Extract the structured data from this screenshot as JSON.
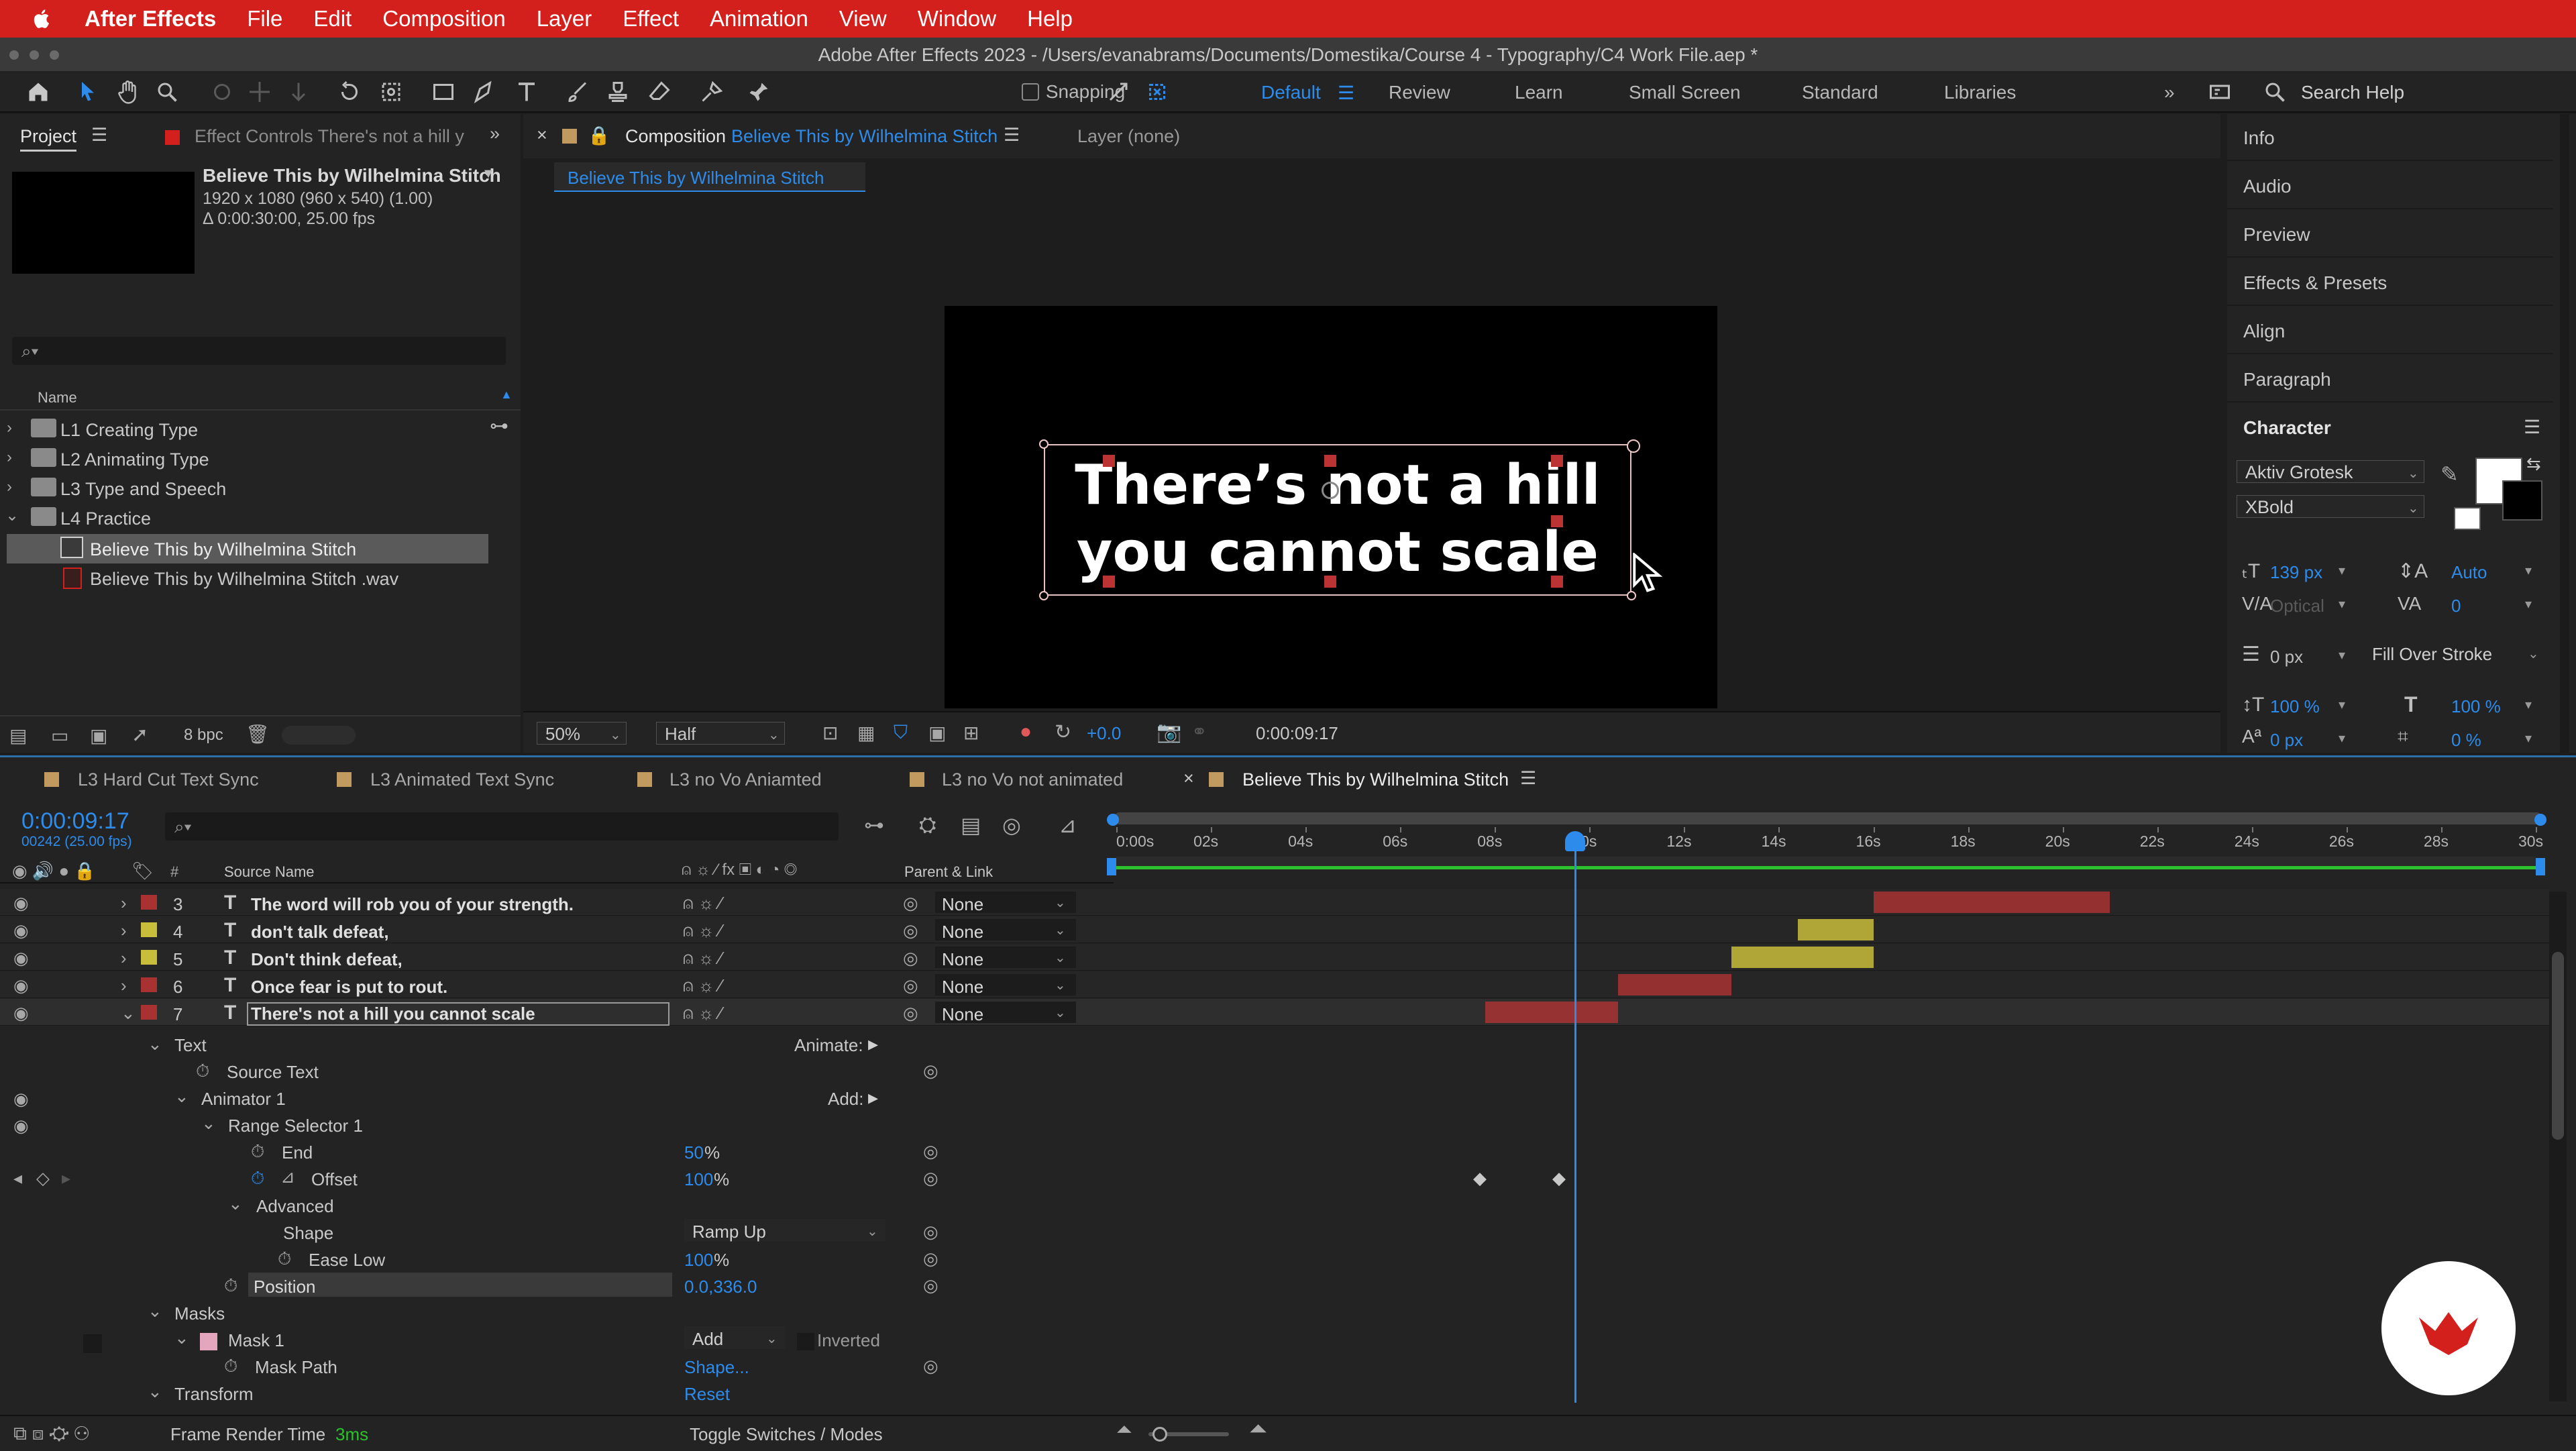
{
  "menubar": {
    "app": "After Effects",
    "items": [
      "File",
      "Edit",
      "Composition",
      "Layer",
      "Effect",
      "Animation",
      "View",
      "Window",
      "Help"
    ]
  },
  "window": {
    "title": "Adobe After Effects 2023 - /Users/evanabrams/Documents/Domestika/Course 4 - Typography/C4 Work File.aep *"
  },
  "toolbar": {
    "snapping": "Snapping",
    "workspaces": [
      "Default",
      "Review",
      "Learn",
      "Small Screen",
      "Standard",
      "Libraries"
    ],
    "search": "Search Help"
  },
  "project": {
    "tab_project": "Project",
    "tab_effects": "Effect Controls There's not a hill y",
    "comp_name": "Believe This by Wilhelmina Stitch",
    "comp_size": "1920 x 1080  (960 x 540) (1.00)",
    "comp_dur": "Δ 0:00:30:00, 25.00 fps",
    "col_name": "Name",
    "items": [
      {
        "label": "L1 Creating Type"
      },
      {
        "label": "L2 Animating Type"
      },
      {
        "label": "L3 Type and Speech"
      },
      {
        "label": "L4 Practice"
      },
      {
        "label": "Believe This by Wilhelmina Stitch"
      },
      {
        "label": "Believe This by Wilhelmina Stitch .wav"
      }
    ],
    "bpc": "8 bpc"
  },
  "composition": {
    "tab_prefix": "Composition",
    "tab_name": "Believe This by Wilhelmina Stitch",
    "layer_tab": "Layer (none)",
    "breadcrumb": "Believe This by Wilhelmina Stitch",
    "canvas_line1": "There’s not a hill",
    "canvas_line2": "you cannot scale",
    "zoom": "50%",
    "resolution": "Half",
    "exposure": "+0.0",
    "timecode": "0:00:09:17"
  },
  "right_panels": [
    "Info",
    "Audio",
    "Preview",
    "Effects & Presets",
    "Align",
    "Paragraph",
    "Character"
  ],
  "character": {
    "font": "Aktiv Grotesk",
    "style": "XBold",
    "size": "139 px",
    "leading": "Auto",
    "kerning": "Optical",
    "tracking": "0",
    "stroke_width": "0 px",
    "stroke_mode": "Fill Over Stroke",
    "vscale": "100 %",
    "hscale": "100 %",
    "baseline": "0 px",
    "tsume": "0 %",
    "fill_color": "#ffffff"
  },
  "timeline": {
    "tabs": [
      "L3 Hard Cut Text Sync",
      "L3 Animated Text Sync",
      "L3 no Vo Aniamted",
      "L3 no Vo not animated",
      "Believe This by Wilhelmina Stitch"
    ],
    "timecode": "0:00:09:17",
    "frames": "00242 (25.00 fps)",
    "col_source": "Source Name",
    "col_parent": "Parent & Link",
    "ruler": [
      "0:00s",
      "02s",
      "04s",
      "06s",
      "08s",
      "10s",
      "12s",
      "14s",
      "16s",
      "18s",
      "20s",
      "22s",
      "24s",
      "26s",
      "28s",
      "30s"
    ],
    "layers": [
      {
        "num": "3",
        "name": "The word will rob you of your strength.",
        "parent": "None",
        "color": "#a83232",
        "start": 16,
        "end": 21
      },
      {
        "num": "4",
        "name": "don't talk defeat,",
        "parent": "None",
        "color": "#c9bd3c",
        "start": 14.4,
        "end": 16
      },
      {
        "num": "5",
        "name": "Don't think defeat,",
        "parent": "None",
        "color": "#c9bd3c",
        "start": 13,
        "end": 16
      },
      {
        "num": "6",
        "name": "Once fear is put to rout.",
        "parent": "None",
        "color": "#a83232",
        "start": 10.6,
        "end": 13
      },
      {
        "num": "7",
        "name": "There's not a hill you cannot scale",
        "parent": "None",
        "color": "#a83232",
        "start": 7.8,
        "end": 10.6
      }
    ],
    "props": {
      "text": "Text",
      "animate": "Animate:",
      "source_text": "Source Text",
      "animator": "Animator 1",
      "add": "Add:",
      "range": "Range Selector 1",
      "end_label": "End",
      "end_val": "50",
      "offset_label": "Offset",
      "offset_val": "100",
      "advanced": "Advanced",
      "shape_label": "Shape",
      "shape_val": "Ramp Up",
      "ease_label": "Ease Low",
      "ease_val": "100",
      "position_label": "Position",
      "position_val": "0.0,336.0",
      "masks": "Masks",
      "mask1": "Mask 1",
      "mask_mode": "Add",
      "inverted": "Inverted",
      "mask_path": "Mask Path",
      "mask_path_val": "Shape...",
      "transform": "Transform",
      "reset": "Reset",
      "pct": "%"
    },
    "footer": {
      "render_label": "Frame Render Time",
      "render_val": "3ms",
      "toggle": "Toggle Switches / Modes"
    },
    "playhead_seconds": 9.7
  }
}
